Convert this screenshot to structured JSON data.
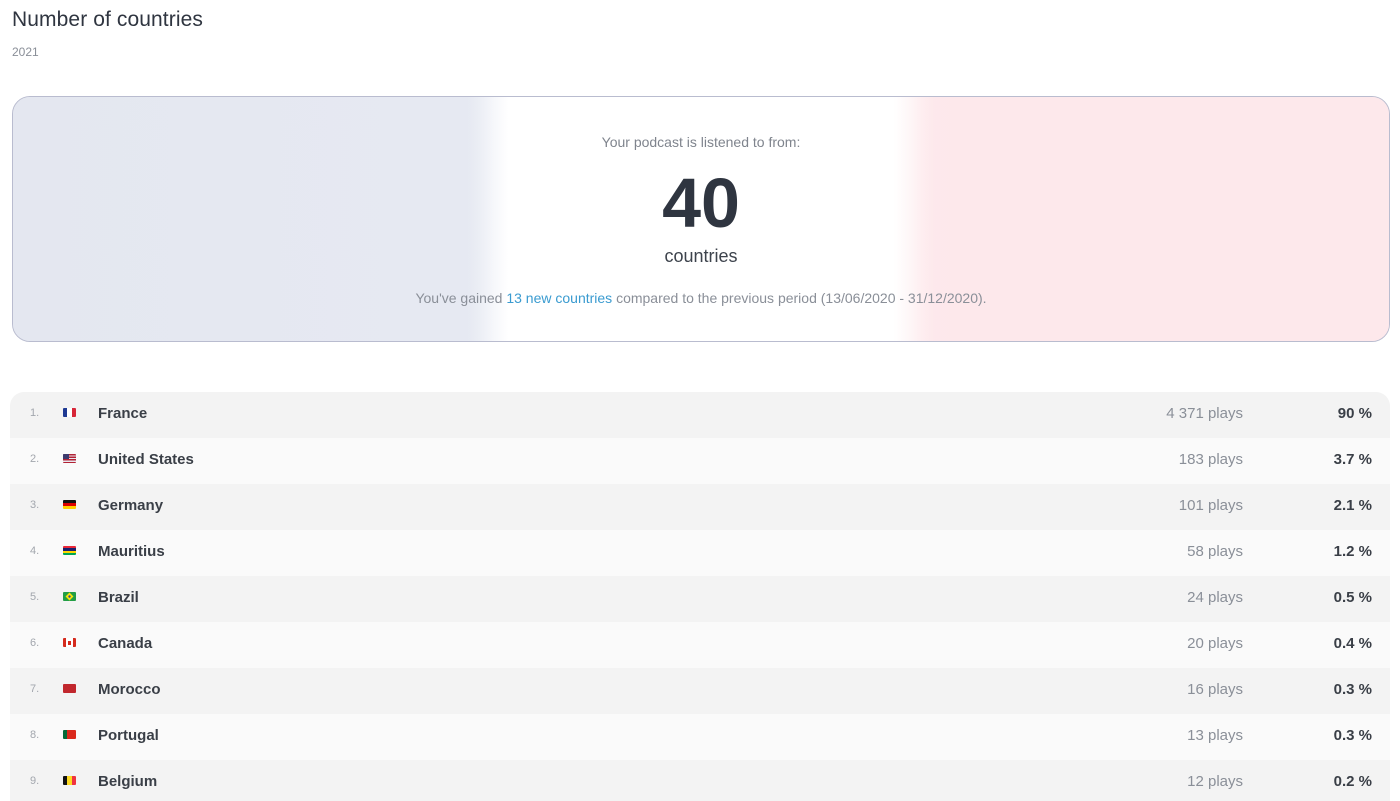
{
  "header": {
    "title": "Number of countries",
    "year": "2021"
  },
  "summary": {
    "listened_label": "Your podcast is listened to from:",
    "count": "40",
    "unit": "countries",
    "gained_prefix": "You've gained ",
    "gained_link": "13 new countries",
    "gained_suffix": " compared to the previous period (13/06/2020 - 31/12/2020)."
  },
  "countries": [
    {
      "rank": "1.",
      "name": "France",
      "plays": "4 371 plays",
      "pct": "90 %",
      "flag": [
        "#1f3a93",
        "#ffffff",
        "#d72638"
      ],
      "flag_dir": "v"
    },
    {
      "rank": "2.",
      "name": "United States",
      "plays": "183 plays",
      "pct": "3.7 %",
      "flag": [
        "#3c3b6e",
        "#e8e8f0",
        "#b22234"
      ],
      "flag_dir": "us"
    },
    {
      "rank": "3.",
      "name": "Germany",
      "plays": "101 plays",
      "pct": "2.1 %",
      "flag": [
        "#111111",
        "#dd0000",
        "#ffce00"
      ],
      "flag_dir": "h"
    },
    {
      "rank": "4.",
      "name": "Mauritius",
      "plays": "58 plays",
      "pct": "1.2 %",
      "flag": [
        "#ea2839",
        "#1a206d",
        "#ffd500",
        "#00a551"
      ],
      "flag_dir": "h"
    },
    {
      "rank": "5.",
      "name": "Brazil",
      "plays": "24 plays",
      "pct": "0.5 %",
      "flag": [
        "#229e45",
        "#f8e509",
        "#2b49a3"
      ],
      "flag_dir": "br"
    },
    {
      "rank": "6.",
      "name": "Canada",
      "plays": "20 plays",
      "pct": "0.4 %",
      "flag": [
        "#d52b1e",
        "#ffffff",
        "#d52b1e"
      ],
      "flag_dir": "ca"
    },
    {
      "rank": "7.",
      "name": "Morocco",
      "plays": "16 plays",
      "pct": "0.3 %",
      "flag": [
        "#c1272d",
        "#c1272d",
        "#c1272d"
      ],
      "flag_dir": "h"
    },
    {
      "rank": "8.",
      "name": "Portugal",
      "plays": "13 plays",
      "pct": "0.3 %",
      "flag": [
        "#046a38",
        "#da291c",
        "#da291c"
      ],
      "flag_dir": "v"
    },
    {
      "rank": "9.",
      "name": "Belgium",
      "plays": "12 plays",
      "pct": "0.2 %",
      "flag": [
        "#111111",
        "#fdda24",
        "#ef3340"
      ],
      "flag_dir": "v"
    }
  ]
}
